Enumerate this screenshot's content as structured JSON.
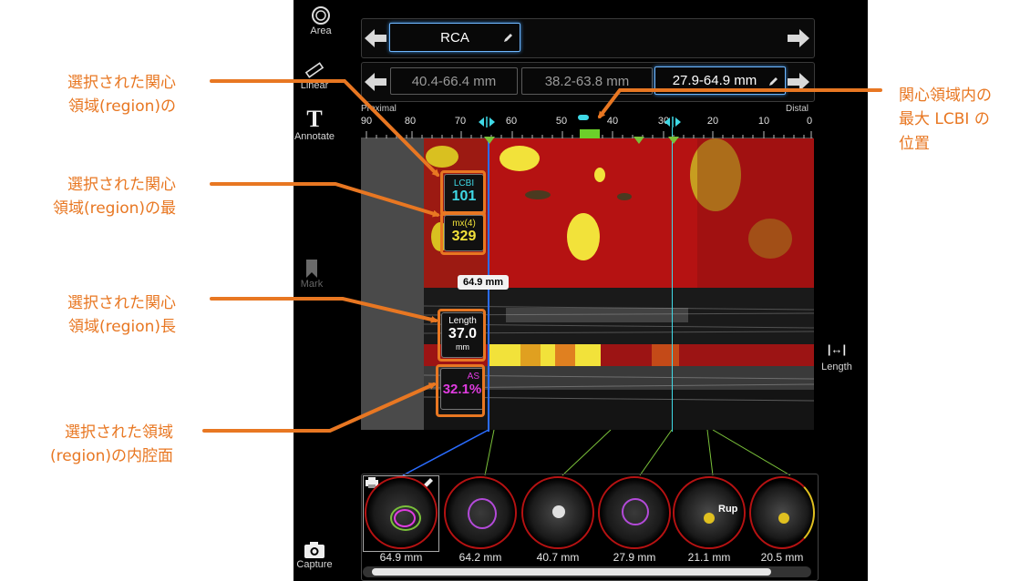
{
  "callouts": {
    "roi": [
      "選択された関心",
      "領域(region)の"
    ],
    "max": [
      "選択された関心",
      "領域(region)の最"
    ],
    "length": [
      "選択された関心",
      "領域(region)長"
    ],
    "lumen": [
      "選択された領域",
      "(region)の内腔面"
    ],
    "right": [
      "関心領域内の",
      "最大 LCBI の",
      "位置"
    ]
  },
  "toolbar": {
    "area": "Area",
    "linear": "Linear",
    "annotate": "Annotate",
    "annotate_glyph": "T",
    "mark": "Mark",
    "capture": "Capture"
  },
  "vessel": {
    "name": "RCA"
  },
  "regions": [
    "40.4-66.4 mm",
    "38.2-63.8 mm",
    "27.9-64.9 mm"
  ],
  "ruler": {
    "left_label": "Proximal",
    "right_label": "Distal",
    "ticks": [
      "90",
      "80",
      "70",
      "60",
      "50",
      "40",
      "30",
      "20",
      "10",
      "0"
    ]
  },
  "metrics": {
    "lcbi_label": "LCBI",
    "lcbi_value": "101",
    "max_label": "mx(4)",
    "max_value": "329",
    "length_label": "Length",
    "length_value": "37.0",
    "length_unit": "mm",
    "as_label": "AS",
    "as_value": "32.1%"
  },
  "position_marker": "64.9 mm",
  "right_tool": {
    "label": "Length",
    "icon": "length-measure-icon"
  },
  "thumbnails": [
    "64.9 mm",
    "64.2 mm",
    "40.7 mm",
    "27.9 mm",
    "21.1 mm",
    "20.5 mm"
  ],
  "thumb_annotation": "Rup",
  "colors": {
    "accent": "#e87722",
    "cyan": "#3fd9e6",
    "yellow": "#f2e23a",
    "magenta": "#e03ce0",
    "chemogram": "#b51212"
  }
}
